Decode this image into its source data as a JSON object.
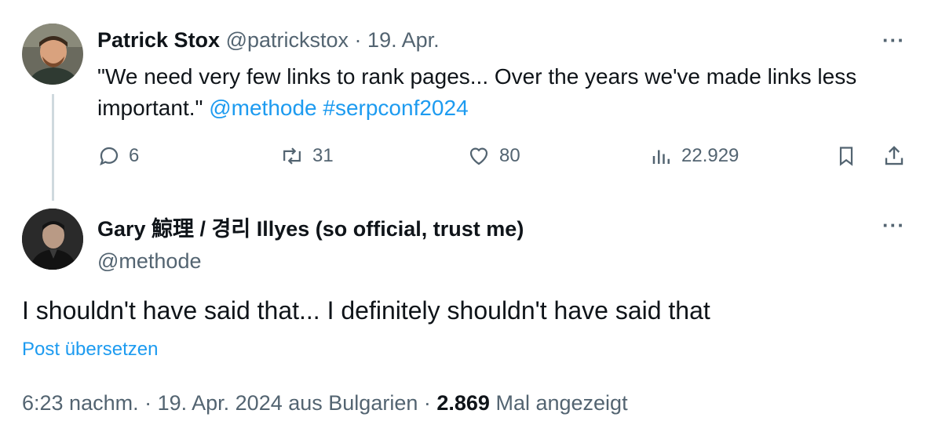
{
  "parent_tweet": {
    "author_name": "Patrick Stox",
    "handle": "@patrickstox",
    "separator": " · ",
    "date": "19. Apr.",
    "text": "\"We need very few links to rank pages... Over the years we've made links less important.\"",
    "mention": "@methode",
    "hashtag": "#serpconf2024",
    "metrics": {
      "replies": "6",
      "reposts": "31",
      "likes": "80",
      "views": "22.929"
    },
    "icons": [
      "reply-icon",
      "repost-icon",
      "like-icon",
      "views-icon",
      "bookmark-icon",
      "share-icon",
      "more-icon"
    ]
  },
  "main_tweet": {
    "author_name": "Gary 鯨理 / 경리 Illyes (so official, trust me)",
    "handle": "@methode",
    "text": "I shouldn't have said that... I definitely shouldn't have said that",
    "translate_label": "Post übersetzen",
    "time": "6:23 nachm.",
    "date": "19. Apr. 2024",
    "location": "aus Bulgarien",
    "views_count": "2.869",
    "views_label": "Mal angezeigt",
    "separator": " · "
  },
  "colors": {
    "text": "#0f1419",
    "secondary": "#536471",
    "link": "#1d9bf0",
    "thread_line": "#cfd9de"
  }
}
